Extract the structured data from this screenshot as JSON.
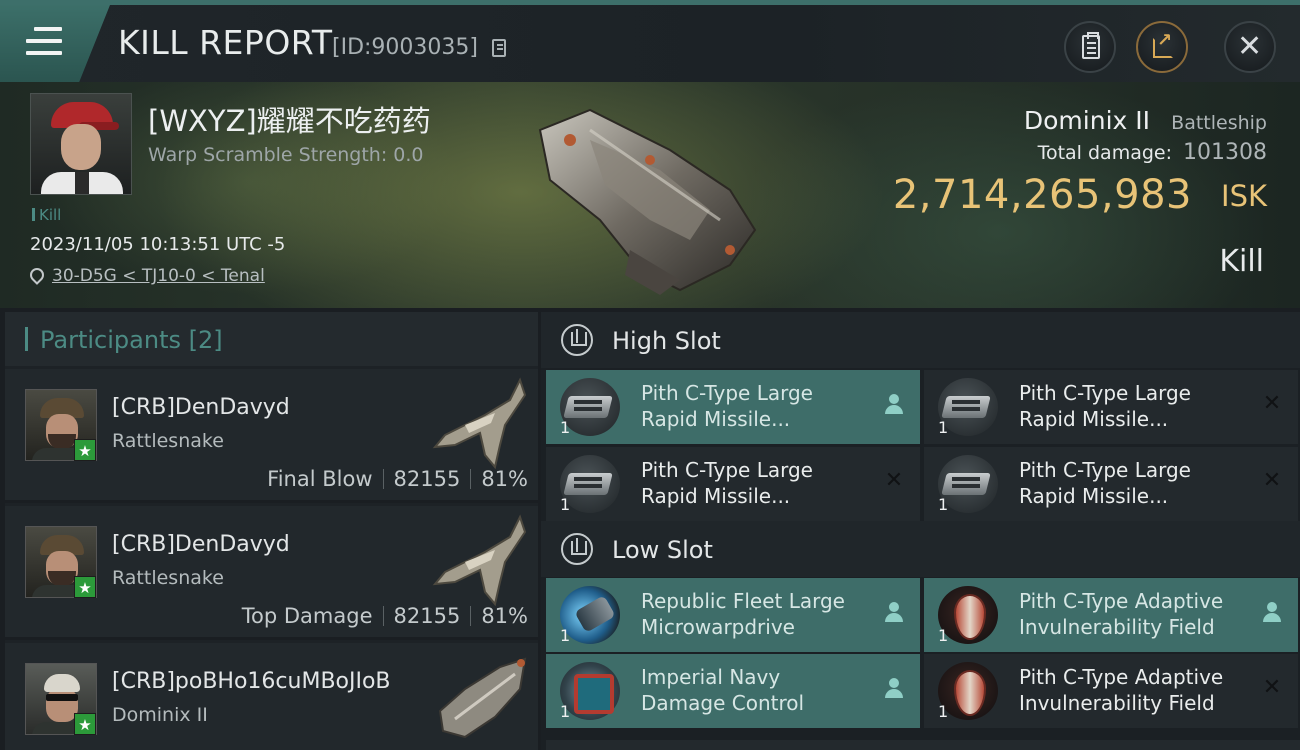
{
  "header": {
    "title": "KILL REPORT",
    "report_id": "[ID:9003035]",
    "icons": [
      "menu-icon",
      "copy-icon",
      "clipboard-icon",
      "share-icon",
      "close-icon"
    ]
  },
  "victim": {
    "name": "[WXYZ]耀耀不吃药药",
    "warp_scramble": "Warp Scramble Strength: 0.0",
    "tag": "Kill",
    "datetime": "2023/11/05 10:13:51 UTC -5",
    "location": "30-D5G < TJ10-0 < Tenal",
    "ship_name": "Dominix II",
    "ship_class": "Battleship",
    "total_damage_label": "Total damage:",
    "total_damage": "101308",
    "isk_value": "2,714,265,983",
    "isk_unit": "ISK",
    "result": "Kill"
  },
  "participants": {
    "title": "Participants [2]",
    "rows": [
      {
        "name": "[CRB]DenDavyd",
        "ship": "Rattlesnake",
        "role": "Final Blow",
        "damage": "82155",
        "percent": "81%"
      },
      {
        "name": "[CRB]DenDavyd",
        "ship": "Rattlesnake",
        "role": "Top Damage",
        "damage": "82155",
        "percent": "81%"
      },
      {
        "name": "[CRB]poBHo16cuMBoJIoB",
        "ship": "Dominix II"
      }
    ]
  },
  "high_slot": {
    "title": "High Slot",
    "modules": [
      {
        "line1": "Pith C-Type Large",
        "line2": "Rapid Missile...",
        "qty": "1",
        "fitted": true
      },
      {
        "line1": "Pith C-Type Large",
        "line2": "Rapid Missile...",
        "qty": "1",
        "fitted": false
      },
      {
        "line1": "Pith C-Type Large",
        "line2": "Rapid Missile...",
        "qty": "1",
        "fitted": false
      },
      {
        "line1": "Pith C-Type Large",
        "line2": "Rapid Missile...",
        "qty": "1",
        "fitted": false
      }
    ]
  },
  "low_slot": {
    "title": "Low Slot",
    "modules": [
      {
        "line1": "Republic Fleet Large",
        "line2": "Microwarpdrive",
        "qty": "1",
        "fitted": true
      },
      {
        "line1": "Pith C-Type Adaptive",
        "line2": "Invulnerability Field",
        "qty": "1",
        "fitted": true
      },
      {
        "line1": "Imperial Navy",
        "line2": "Damage Control",
        "qty": "1",
        "fitted": true
      },
      {
        "line1": "Pith C-Type Adaptive",
        "line2": "Invulnerability Field",
        "qty": "1",
        "fitted": false
      }
    ]
  },
  "colors": {
    "accent": "#3e6d69",
    "isk_gold": "#e8c377",
    "badge_green": "#2c9a3a"
  }
}
